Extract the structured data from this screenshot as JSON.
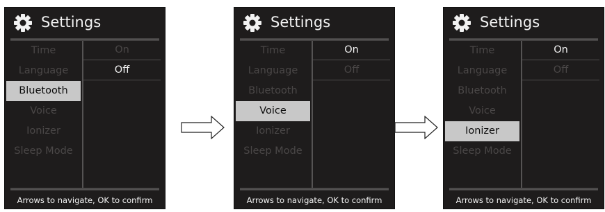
{
  "panels": [
    {
      "title": "Settings",
      "icon": "gear-icon",
      "menu": [
        "Time",
        "Language",
        "Bluetooth",
        "Voice",
        "Ionizer",
        "Sleep Mode"
      ],
      "selected_index": 2,
      "options": [
        "On",
        "Off"
      ],
      "active_option_index": 1,
      "footer": "Arrows to navigate, OK to confirm"
    },
    {
      "title": "Settings",
      "icon": "gear-icon",
      "menu": [
        "Time",
        "Language",
        "Bluetooth",
        "Voice",
        "Ionizer",
        "Sleep Mode"
      ],
      "selected_index": 3,
      "options": [
        "On",
        "Off"
      ],
      "active_option_index": 0,
      "footer": "Arrows to navigate, OK to confirm"
    },
    {
      "title": "Settings",
      "icon": "gear-icon",
      "menu": [
        "Time",
        "Language",
        "Bluetooth",
        "Voice",
        "Ionizer",
        "Sleep Mode"
      ],
      "selected_index": 4,
      "options": [
        "On",
        "Off"
      ],
      "active_option_index": 0,
      "footer": "Arrows to navigate, OK to confirm"
    }
  ],
  "arrows": [
    "right-arrow-icon",
    "right-arrow-icon"
  ],
  "colors": {
    "screen_bg": "#1e1c1c",
    "selected_bg": "#c8c8c8",
    "text_active": "#f2f2f2",
    "text_dim": "#4a4747"
  }
}
